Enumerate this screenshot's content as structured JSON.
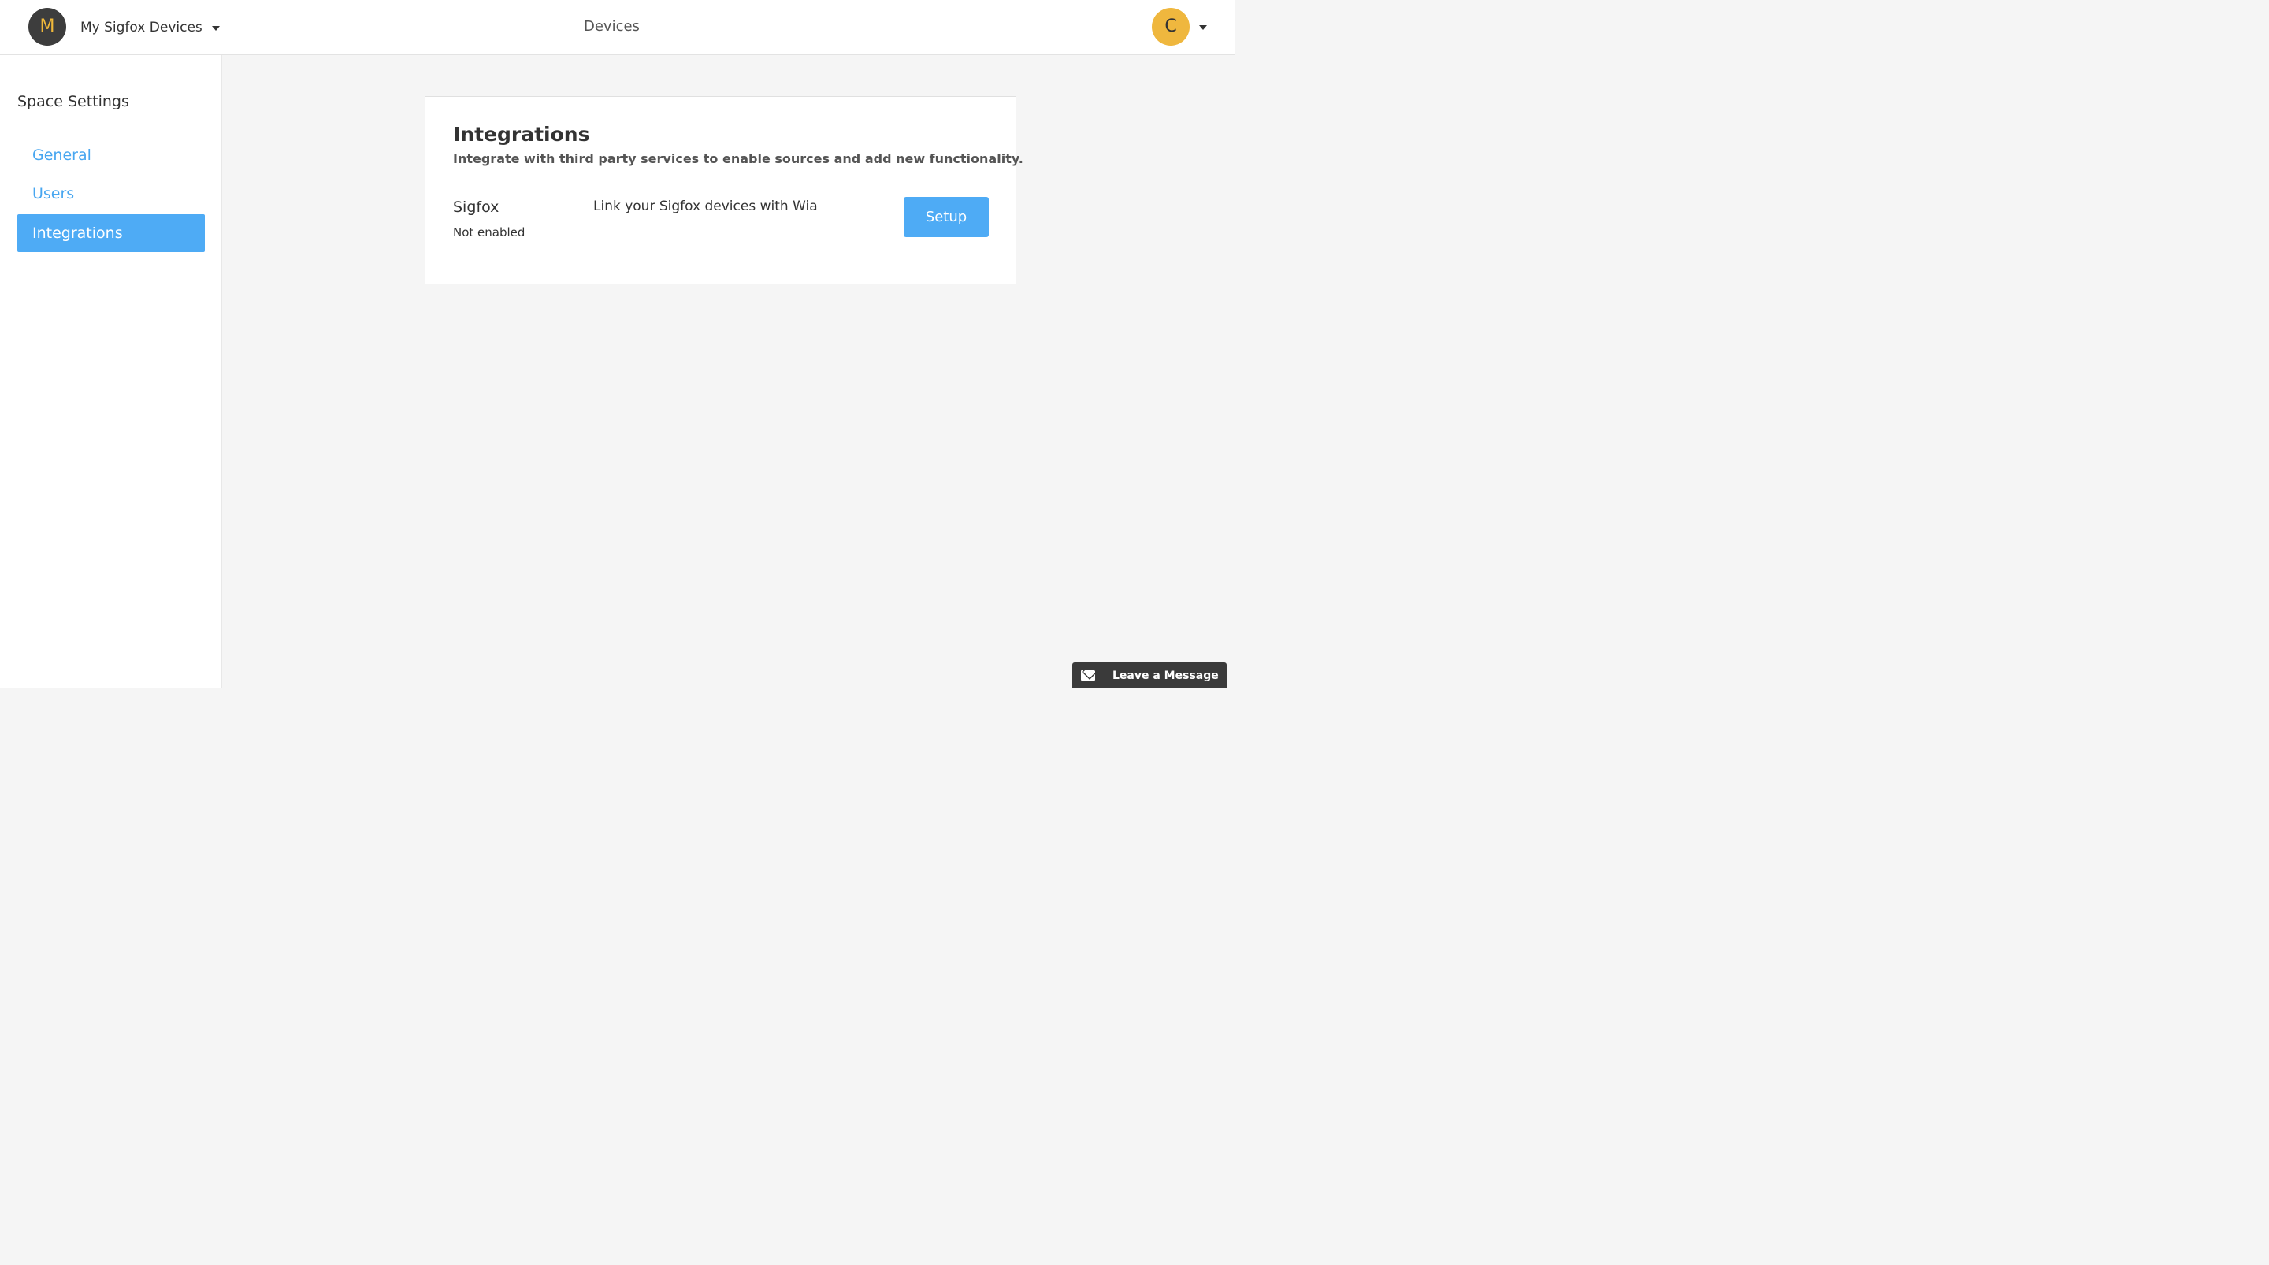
{
  "header": {
    "space_initial": "M",
    "space_name": "My Sigfox Devices",
    "nav_devices": "Devices",
    "user_initial": "C"
  },
  "sidebar": {
    "title": "Space Settings",
    "items": [
      {
        "label": "General",
        "active": false
      },
      {
        "label": "Users",
        "active": false
      },
      {
        "label": "Integrations",
        "active": true
      }
    ]
  },
  "integrations": {
    "title": "Integrations",
    "subtitle": "Integrate with third party services to enable sources and add new functionality.",
    "items": [
      {
        "name": "Sigfox",
        "status": "Not enabled",
        "description": "Link your Sigfox devices with Wia",
        "button_label": "Setup"
      }
    ]
  },
  "chat_widget": {
    "label": "Leave a Message",
    "icon": "mail-icon"
  },
  "colors": {
    "accent": "#4eabf5",
    "space_avatar_bg": "#3d3d3d",
    "space_avatar_text": "#f0b93a",
    "user_avatar_bg": "#efb73e",
    "chat_widget_bg": "#3a3a3a"
  }
}
